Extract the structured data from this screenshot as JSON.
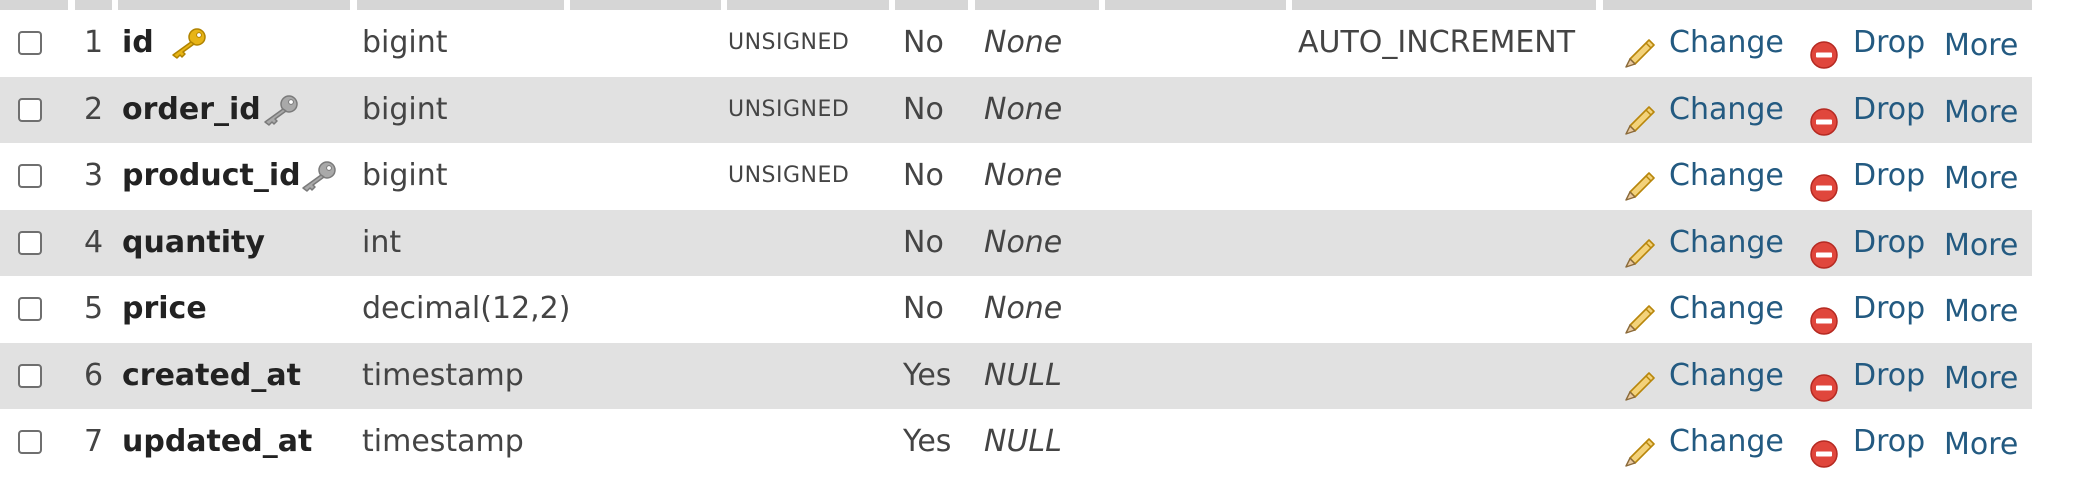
{
  "columns": [
    {
      "num": "1",
      "name": "id",
      "key": "primary",
      "type": "bigint",
      "attributes": "UNSIGNED",
      "null": "No",
      "default": "None",
      "extra": "AUTO_INCREMENT"
    },
    {
      "num": "2",
      "name": "order_id",
      "key": "index",
      "type": "bigint",
      "attributes": "UNSIGNED",
      "null": "No",
      "default": "None",
      "extra": ""
    },
    {
      "num": "3",
      "name": "product_id",
      "key": "index",
      "type": "bigint",
      "attributes": "UNSIGNED",
      "null": "No",
      "default": "None",
      "extra": ""
    },
    {
      "num": "4",
      "name": "quantity",
      "key": "",
      "type": "int",
      "attributes": "",
      "null": "No",
      "default": "None",
      "extra": ""
    },
    {
      "num": "5",
      "name": "price",
      "key": "",
      "type": "decimal(12,2)",
      "attributes": "",
      "null": "No",
      "default": "None",
      "extra": ""
    },
    {
      "num": "6",
      "name": "created_at",
      "key": "",
      "type": "timestamp",
      "attributes": "",
      "null": "Yes",
      "default": "NULL",
      "extra": ""
    },
    {
      "num": "7",
      "name": "updated_at",
      "key": "",
      "type": "timestamp",
      "attributes": "",
      "null": "Yes",
      "default": "NULL",
      "extra": ""
    }
  ],
  "actions": {
    "change": "Change",
    "drop": "Drop",
    "more": "More"
  },
  "icons": {
    "primary_key": "gold-key-icon",
    "index_key": "gray-key-icon",
    "change": "pencil-icon",
    "drop": "drop-circle-icon"
  },
  "colors": {
    "row_alt": "#e1e1e1",
    "link": "#235a81",
    "drop_icon": "#e0463c",
    "primary_key": "#e7b416",
    "index_key": "#a9a9a9"
  }
}
